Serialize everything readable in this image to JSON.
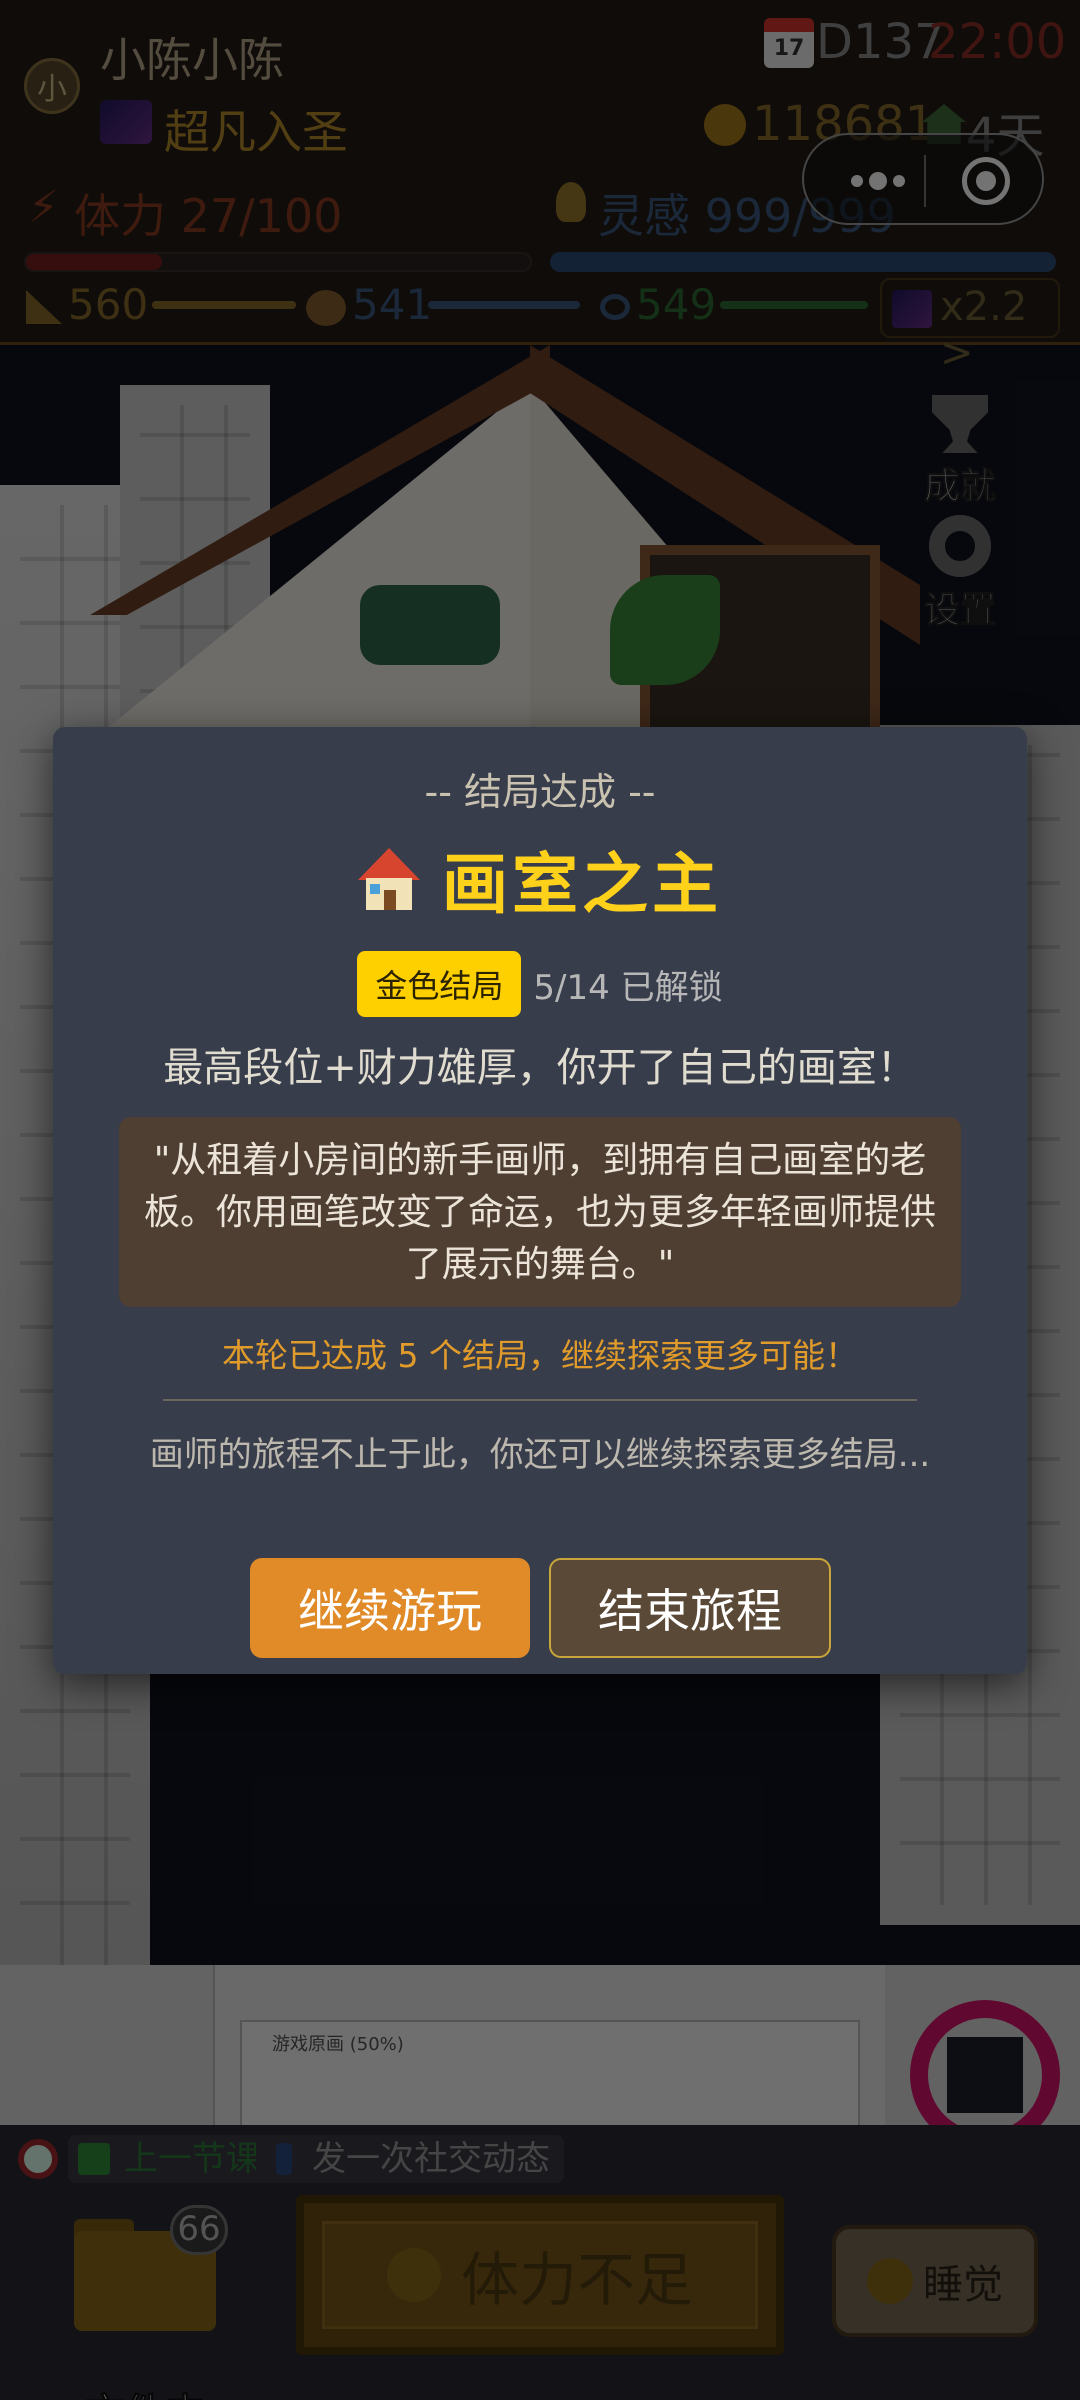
{
  "hud": {
    "avatar_letter": "小",
    "player_name": "小陈小陈",
    "rank_label": "超凡入圣",
    "calendar_text": "17",
    "day_label": "D137",
    "time_label": "22:00",
    "coins": "118681",
    "days": "4天",
    "energy_label": "体力 27/100",
    "energy_fraction": 0.27,
    "inspiration_label": "灵感 999/999",
    "inspiration_fraction": 1.0,
    "stats": [
      {
        "name": "skill",
        "value": "560",
        "color": "#8a6a2a"
      },
      {
        "name": "art",
        "value": "541",
        "color": "#3b5a80"
      },
      {
        "name": "vision",
        "value": "549",
        "color": "#2d6b34"
      }
    ],
    "multiplier_label": "x2.2 >"
  },
  "side_buttons": {
    "achievements": "成就",
    "settings": "设置"
  },
  "software": {
    "canvas_title": "游戏原画 (50%)"
  },
  "modal": {
    "header": "-- 结局达成 --",
    "title": "画室之主",
    "badge": "金色结局",
    "unlock_count": "5/14 已解锁",
    "description": "最高段位+财力雄厚，你开了自己的画室！",
    "quote": "\"从租着小房间的新手画师，到拥有自己画室的老板。你用画笔改变了命运，也为更多年轻画师提供了展示的舞台。\"",
    "progress_note": "本轮已达成 5 个结局，继续探索更多可能！",
    "journey_note": "画师的旅程不止于此，你还可以继续探索更多结局...",
    "continue_label": "继续游玩",
    "end_label": "结束旅程"
  },
  "bottom": {
    "task1": "上一节课",
    "task2": "发一次社交动态",
    "folder_badge": "66",
    "folder_label": "文件夹",
    "main_action": "体力不足",
    "sleep_label": "睡觉"
  },
  "colors": {
    "accent_gold": "#ffd11a",
    "continue_orange": "#e08a28",
    "modal_bg": "#383d4c"
  }
}
